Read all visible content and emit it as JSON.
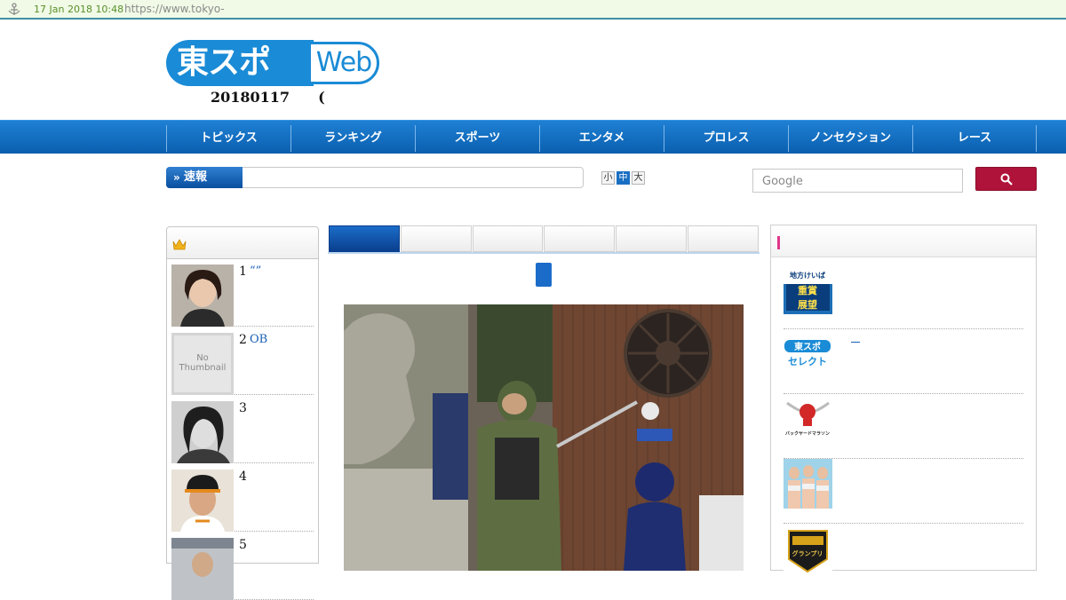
{
  "archive": {
    "date": "17 Jan 2018 10:48",
    "url": "https://www.tokyo-"
  },
  "header": {
    "logo_jp": "東スポ",
    "logo_web": "Web",
    "date": "20180117",
    "date_suffix": "("
  },
  "nav": {
    "items": [
      "トピックス",
      "ランキング",
      "スポーツ",
      "エンタメ",
      "プロレス",
      "ノンセクション",
      "レース"
    ]
  },
  "breaking": {
    "label": "速報",
    "chevron": "»"
  },
  "font_size": {
    "small": "小",
    "medium": "中",
    "large": "大",
    "selected": "中"
  },
  "search": {
    "placeholder": "Google"
  },
  "ranking": {
    "items": [
      {
        "num": "1",
        "title": "“”"
      },
      {
        "num": "2",
        "title": "OB"
      },
      {
        "num": "3",
        "title": ""
      },
      {
        "num": "4",
        "title": ""
      },
      {
        "num": "5",
        "title": ""
      }
    ],
    "no_thumb_line1": "No",
    "no_thumb_line2": "Thumbnail"
  },
  "right_column": {
    "banners": [
      {
        "line1": "地方けいば",
        "line2": "重賞",
        "line3": "展望"
      },
      {
        "line1": "東スポ",
        "line2": "セレクト"
      },
      {
        "line1": "バックヤードマラソン"
      },
      {
        "line1": ""
      },
      {
        "line1": "グランプリ"
      }
    ]
  },
  "colors": {
    "brand_blue": "#1a8bd6",
    "nav_blue": "#0a5fae",
    "search_red": "#b0133a",
    "accent_pink": "#e0358a"
  }
}
